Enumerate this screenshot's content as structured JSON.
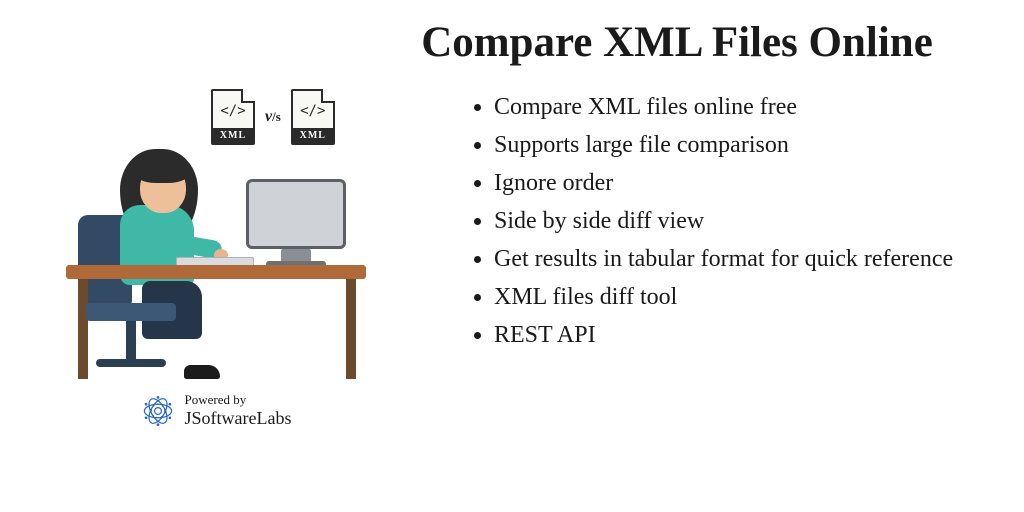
{
  "title": "Compare XML Files Online",
  "badges": {
    "left": {
      "code": "</>",
      "label": "XML"
    },
    "vs_v": "v",
    "vs_s": "/s",
    "right": {
      "code": "</>",
      "label": "XML"
    }
  },
  "bullets": [
    "Compare XML files online free",
    "Supports large file comparison",
    "Ignore order",
    "Side by side diff view",
    "Get results in tabular format for quick reference",
    "XML files diff tool",
    "REST API"
  ],
  "credits": {
    "powered": "Powered by",
    "brand": "JSoftwareLabs"
  }
}
